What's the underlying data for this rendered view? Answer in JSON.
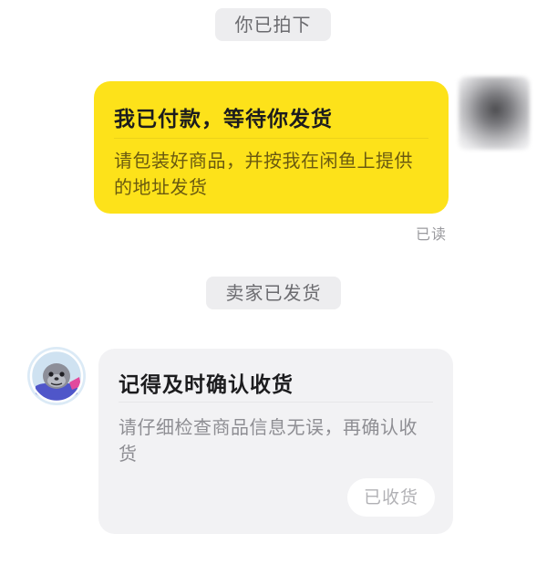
{
  "chat": {
    "system_bought": "你已拍下",
    "system_shipped": "卖家已发货",
    "payment_card": {
      "title": "我已付款，等待你发货",
      "body": "请包装好商品，并按我在闲鱼上提供的地址发货"
    },
    "read_status": "已读",
    "confirm_card": {
      "title": "记得及时确认收货",
      "body": "请仔细检查商品信息无误，再确认收货",
      "button_label": "已收货"
    }
  },
  "colors": {
    "accent_yellow": "#fde21a",
    "card_grey": "#f2f2f4",
    "system_pill": "#ededef"
  },
  "icons": {
    "seller_avatar": "seal-astronaut-avatar",
    "buyer_avatar": "blurred-user-avatar"
  }
}
